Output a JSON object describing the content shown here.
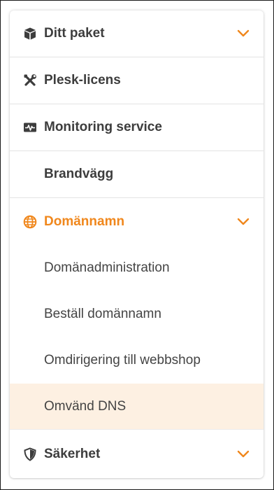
{
  "menu": {
    "items": [
      {
        "label": "Ditt paket",
        "icon": "box-icon",
        "expandable": true
      },
      {
        "label": "Plesk-licens",
        "icon": "tools-icon",
        "expandable": false
      },
      {
        "label": "Monitoring service",
        "icon": "heartbeat-monitor-icon",
        "expandable": false
      },
      {
        "label": "Brandvägg",
        "icon": null,
        "expandable": false
      },
      {
        "label": "Domännamn",
        "icon": "globe-icon",
        "expandable": true,
        "active": true,
        "children": [
          {
            "label": "Domänadministration"
          },
          {
            "label": "Beställ domännamn"
          },
          {
            "label": "Omdirigering till webbshop"
          },
          {
            "label": "Omvänd DNS",
            "highlighted": true
          }
        ]
      },
      {
        "label": "Säkerhet",
        "icon": "shield-icon",
        "expandable": true
      }
    ]
  },
  "colors": {
    "accent": "#f0871c",
    "text": "#3d3d3d",
    "highlight_bg": "#fdf0e2",
    "divider": "#e3e3e3"
  }
}
